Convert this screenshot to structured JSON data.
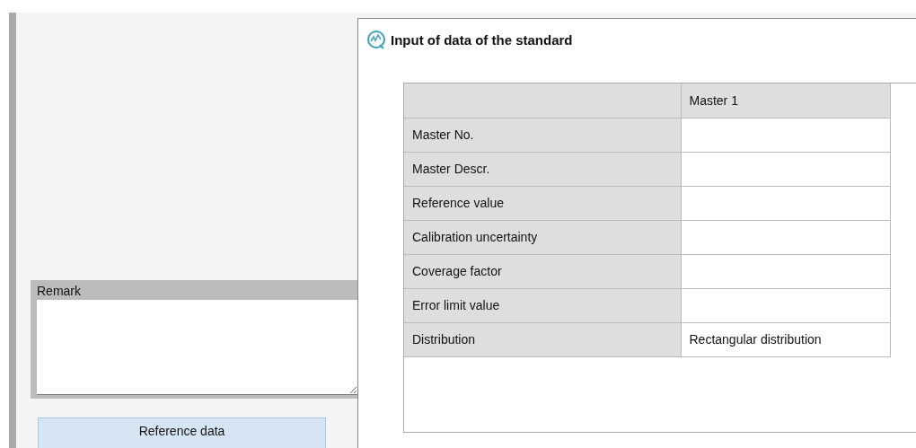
{
  "main": {
    "remark": {
      "label": "Remark"
    },
    "reference_button": "Reference data"
  },
  "dialog": {
    "title": "Input of data of the standard",
    "table": {
      "columns": [
        "Master 1"
      ],
      "rows": [
        {
          "label": "Master No."
        },
        {
          "label": "Master Descr."
        },
        {
          "label": "Reference value"
        },
        {
          "label": "Calibration uncertainty"
        },
        {
          "label": "Coverage factor"
        },
        {
          "label": "Error limit value"
        },
        {
          "label": "Distribution",
          "value": "Rectangular distribution"
        }
      ]
    }
  }
}
